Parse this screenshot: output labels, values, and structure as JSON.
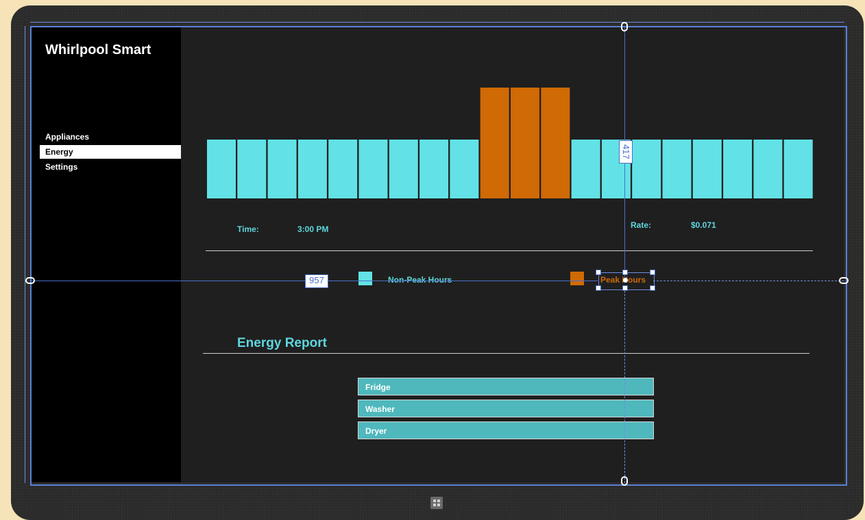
{
  "app": {
    "title": "Whirlpool Smart"
  },
  "nav": {
    "items": [
      {
        "label": "Appliances",
        "active": false
      },
      {
        "label": "Energy",
        "active": true
      },
      {
        "label": "Settings",
        "active": false
      }
    ]
  },
  "energy_chart": {
    "hours": [
      0,
      1,
      2,
      3,
      4,
      5,
      6,
      7,
      8,
      9,
      10,
      11,
      12,
      13,
      14,
      15,
      16,
      17,
      18,
      19
    ],
    "peak_hours": [
      9,
      10,
      11
    ],
    "colors": {
      "non_peak": "#62e2e6",
      "peak": "#cf6a05"
    }
  },
  "info": {
    "time_label": "Time:",
    "time_value": "3:00 PM",
    "rate_label": "Rate:",
    "rate_value": "$0.071"
  },
  "legend": {
    "non_peak_label": "Non-Peak Hours",
    "peak_label": "Peak Hours"
  },
  "report": {
    "title": "Energy Report",
    "items": [
      "Fridge",
      "Washer",
      "Dryer"
    ]
  },
  "designer": {
    "dimension_horizontal": "957",
    "dimension_vertical": "417"
  }
}
